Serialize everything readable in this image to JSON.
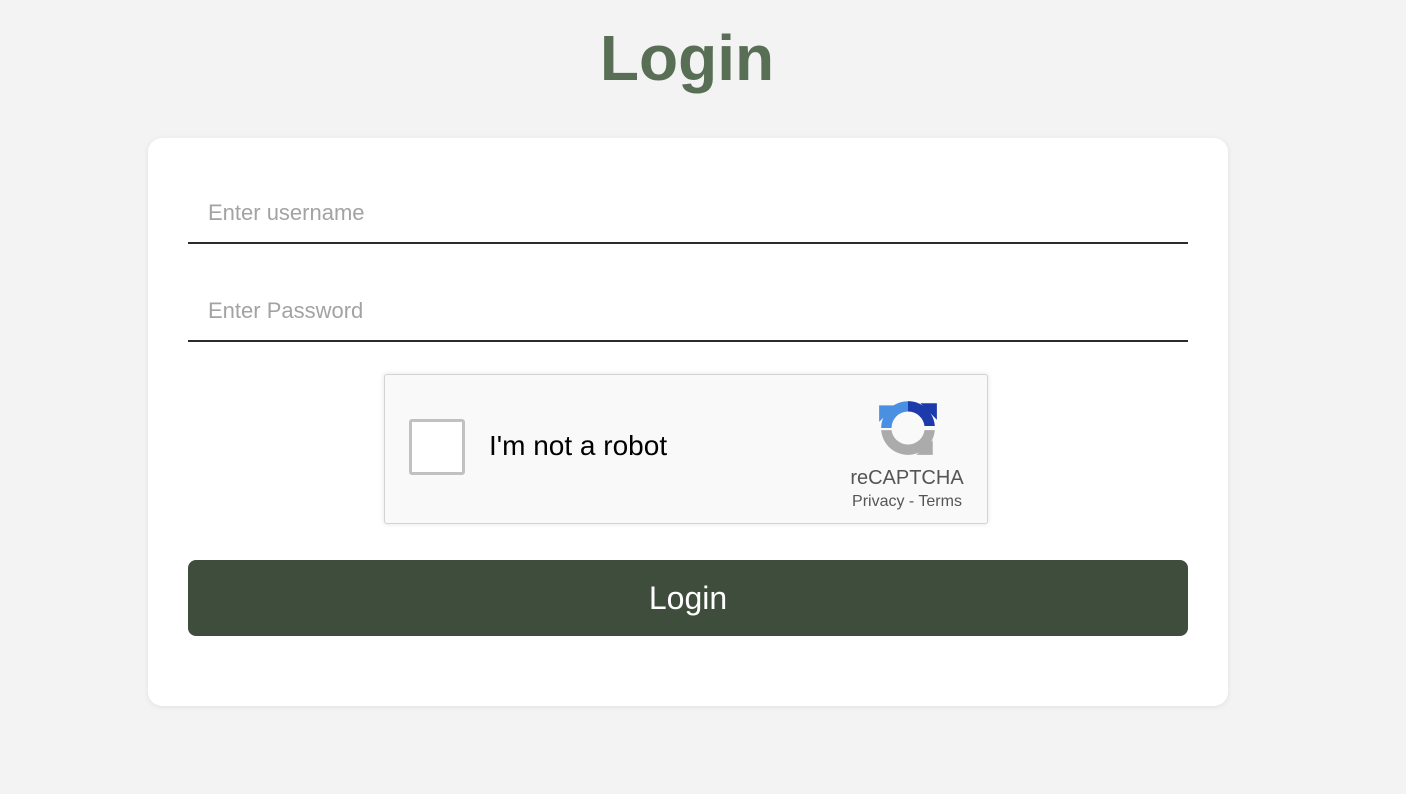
{
  "page": {
    "title": "Login"
  },
  "form": {
    "username_placeholder": "Enter username",
    "username_value": "",
    "password_placeholder": "Enter Password",
    "password_value": "",
    "submit_label": "Login"
  },
  "recaptcha": {
    "label": "I'm not a robot",
    "checked": false,
    "brand": "reCAPTCHA",
    "privacy_label": "Privacy",
    "separator": "-",
    "terms_label": "Terms",
    "icon": "recaptcha-logo-icon"
  },
  "colors": {
    "background": "#f3f3f3",
    "title": "#586f55",
    "button": "#3f4d3c",
    "card": "#ffffff"
  }
}
